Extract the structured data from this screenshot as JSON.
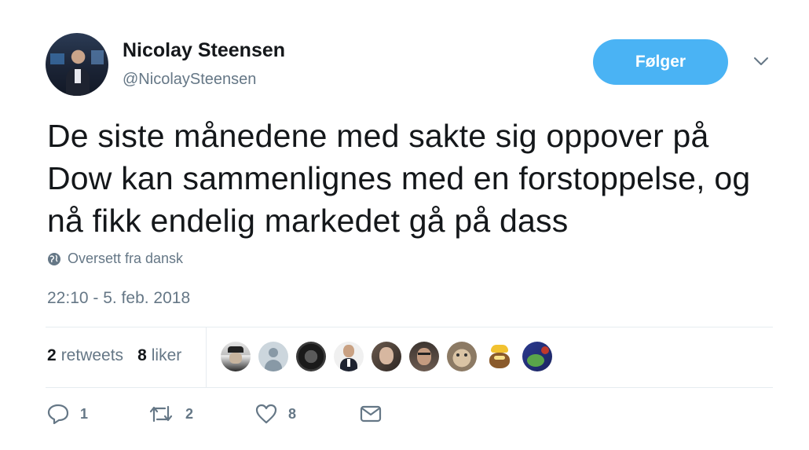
{
  "author": {
    "name": "Nicolay Steensen",
    "handle": "@NicolaySteensen"
  },
  "follow_label": "Følger",
  "tweet_text": "De siste månedene med sakte sig oppover på Dow kan sammenlignes med en forstoppelse, og nå fikk endelig markedet gå på dass",
  "translate_label": "Oversett fra dansk",
  "timestamp": "22:10 - 5. feb. 2018",
  "stats": {
    "retweets_count": "2",
    "retweets_label": "retweets",
    "likes_count": "8",
    "likes_label": "liker"
  },
  "liker_avatars": [
    {
      "icon": "avatar-officer"
    },
    {
      "icon": "avatar-default"
    },
    {
      "icon": "avatar-dark"
    },
    {
      "icon": "avatar-man-suit"
    },
    {
      "icon": "avatar-man-beard"
    },
    {
      "icon": "avatar-man-glasses"
    },
    {
      "icon": "avatar-cat"
    },
    {
      "icon": "avatar-cartoon"
    },
    {
      "icon": "avatar-pepe"
    }
  ],
  "actions": {
    "reply_count": "1",
    "retweet_count": "2",
    "like_count": "8"
  },
  "colors": {
    "accent": "#4ab3f4",
    "muted": "#657786",
    "text": "#14171a"
  }
}
